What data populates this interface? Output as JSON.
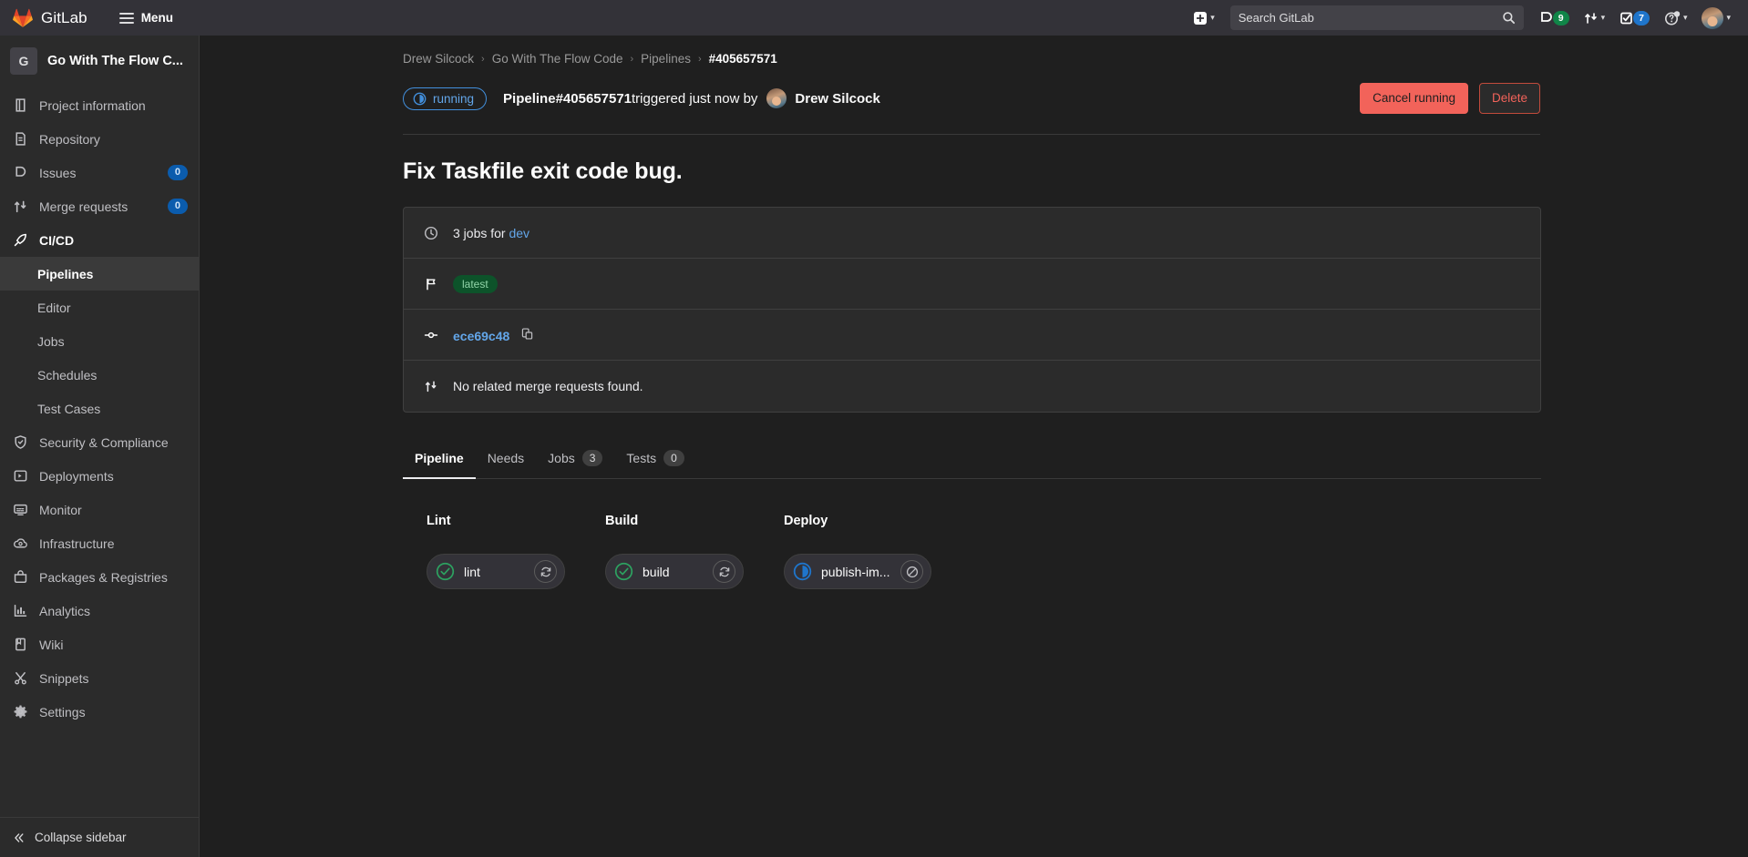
{
  "navbar": {
    "brand": "GitLab",
    "menu_label": "Menu",
    "create_icon": "plus-square-icon",
    "create_chevron": "chevron-down-icon",
    "search_placeholder": "Search GitLab",
    "search_icon": "search-icon",
    "issues_icon": "issues-icon",
    "issues_count": "9",
    "merge_requests_icon": "merge-request-icon",
    "merge_chevron": "chevron-down-icon",
    "todos_icon": "todo-check-icon",
    "todos_count": "7",
    "help_icon": "question-circle-icon",
    "help_chevron": "chevron-down-icon",
    "avatar_icon": "user-avatar",
    "avatar_chevron": "chevron-down-icon"
  },
  "sidebar": {
    "project_initial": "G",
    "project_name": "Go With The Flow C...",
    "items": [
      {
        "label": "Project information",
        "icon": "book-icon",
        "badge": null
      },
      {
        "label": "Repository",
        "icon": "document-icon",
        "badge": null
      },
      {
        "label": "Issues",
        "icon": "issues-icon",
        "badge": "0"
      },
      {
        "label": "Merge requests",
        "icon": "merge-request-icon",
        "badge": "0"
      },
      {
        "label": "CI/CD",
        "icon": "rocket-icon",
        "badge": null,
        "active": true
      }
    ],
    "subitems": [
      {
        "label": "Pipelines",
        "current": true
      },
      {
        "label": "Editor",
        "current": false
      },
      {
        "label": "Jobs",
        "current": false
      },
      {
        "label": "Schedules",
        "current": false
      },
      {
        "label": "Test Cases",
        "current": false
      }
    ],
    "items2": [
      {
        "label": "Security & Compliance",
        "icon": "shield-icon"
      },
      {
        "label": "Deployments",
        "icon": "deployments-icon"
      },
      {
        "label": "Monitor",
        "icon": "monitor-icon"
      },
      {
        "label": "Infrastructure",
        "icon": "cloud-gear-icon"
      },
      {
        "label": "Packages & Registries",
        "icon": "package-icon"
      },
      {
        "label": "Analytics",
        "icon": "chart-icon"
      },
      {
        "label": "Wiki",
        "icon": "book-open-icon"
      },
      {
        "label": "Snippets",
        "icon": "snippet-icon"
      },
      {
        "label": "Settings",
        "icon": "gear-icon"
      }
    ],
    "collapse_label": "Collapse sidebar",
    "collapse_icon": "chevron-double-left-icon"
  },
  "breadcrumb": {
    "items": [
      "Drew Silcock",
      "Go With The Flow Code",
      "Pipelines"
    ],
    "current": "#405657571",
    "separator": "›"
  },
  "pipeline": {
    "status_label": "running",
    "status_icon": "status-running-icon",
    "title_prefix": "Pipeline ",
    "pipeline_id": "#405657571",
    "triggered_text": " triggered just now by ",
    "author": "Drew Silcock",
    "author_avatar_icon": "user-avatar",
    "cancel_label": "Cancel running",
    "delete_label": "Delete",
    "commit_title": "Fix Taskfile exit code bug."
  },
  "info_card": {
    "jobs_icon": "clock-icon",
    "jobs_text": "3 jobs for ",
    "jobs_branch": "dev",
    "tag_icon": "flag-icon",
    "tag_label": "latest",
    "commit_icon": "commit-icon",
    "commit_sha": "ece69c48",
    "copy_icon": "copy-icon",
    "mr_icon": "merge-request-icon",
    "mr_text": "No related merge requests found."
  },
  "tabs": [
    {
      "label": "Pipeline",
      "count": null,
      "active": true
    },
    {
      "label": "Needs",
      "count": null,
      "active": false
    },
    {
      "label": "Jobs",
      "count": "3",
      "active": false
    },
    {
      "label": "Tests",
      "count": "0",
      "active": false
    }
  ],
  "graph": {
    "stages": [
      {
        "name": "Lint",
        "job_name": "lint",
        "job_status": "success",
        "status_icon": "status-success-icon",
        "action_icon": "retry-icon"
      },
      {
        "name": "Build",
        "job_name": "build",
        "job_status": "success",
        "status_icon": "status-success-icon",
        "action_icon": "retry-icon"
      },
      {
        "name": "Deploy",
        "job_name": "publish-im...",
        "job_status": "running",
        "status_icon": "status-running-icon",
        "action_icon": "cancel-icon"
      }
    ]
  },
  "colors": {
    "accent_blue": "#63a6e9",
    "success_green": "#108548",
    "danger_red": "#f2635a",
    "running_blue": "#1f75cb",
    "page_bg": "#1f1f1f",
    "panel_bg": "#2b2b2b"
  }
}
